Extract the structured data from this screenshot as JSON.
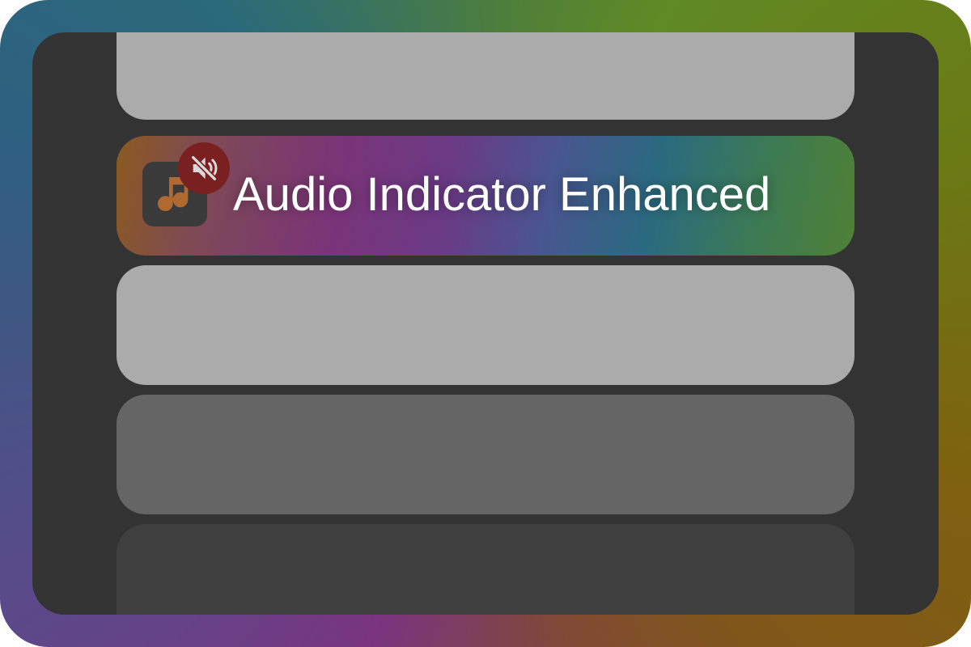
{
  "list": {
    "items": [
      {
        "state": "light",
        "label": ""
      },
      {
        "state": "active",
        "label": "Audio Indicator Enhanced",
        "icon": "music-note-icon",
        "badge_icon": "speaker-muted-icon"
      },
      {
        "state": "light",
        "label": ""
      },
      {
        "state": "mid",
        "label": ""
      },
      {
        "state": "dark",
        "label": ""
      }
    ]
  },
  "colors": {
    "panel": "#333333",
    "row_light": "#ababab",
    "row_mid": "#656565",
    "row_dark": "#3f3f3f",
    "mute_badge": "#7a2020",
    "icon_accent": "#b06a30",
    "text": "#ffffff"
  }
}
